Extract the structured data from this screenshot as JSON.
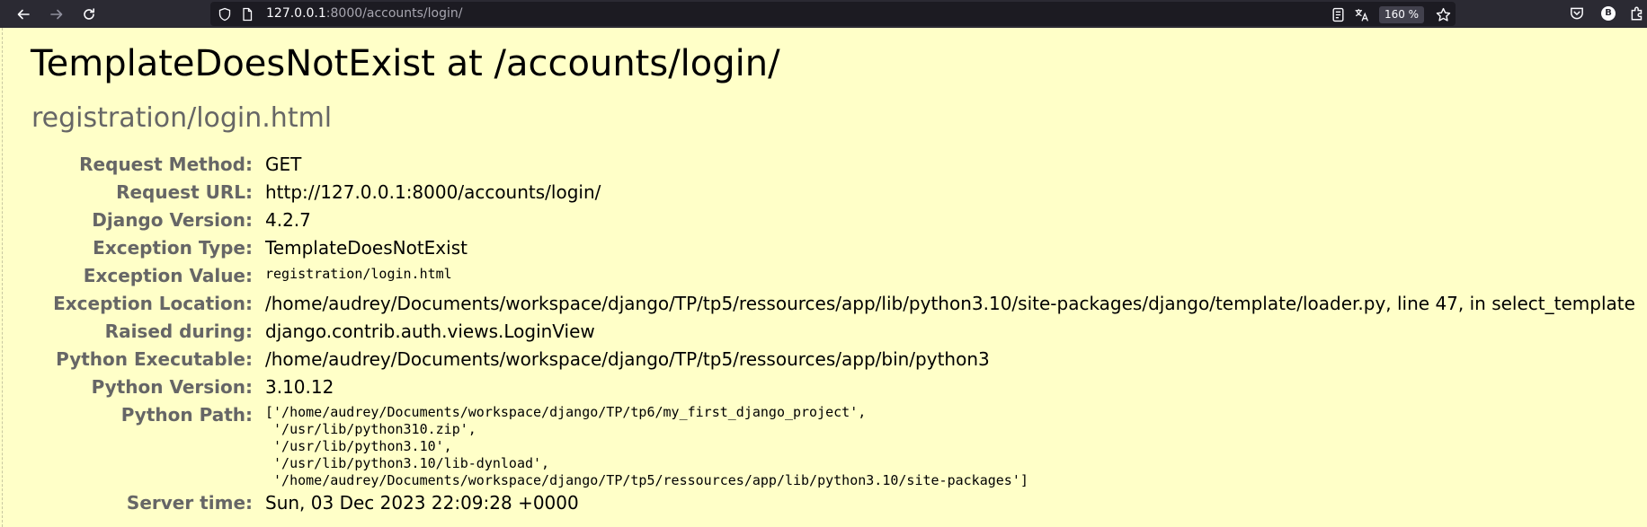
{
  "browser": {
    "url_host": "127.0.0.1",
    "url_path": ":8000/accounts/login/",
    "zoom": "160 %",
    "account_initial": "B",
    "icons": [
      "back-icon",
      "forward-icon",
      "reload-icon",
      "shield-icon",
      "page-icon",
      "reader-view-icon",
      "translate-icon",
      "bookmark-star-icon",
      "pocket-icon",
      "extensions-icon"
    ]
  },
  "page": {
    "title": "TemplateDoesNotExist at /accounts/login/",
    "subtitle": "registration/login.html",
    "rows": [
      {
        "label": "Request Method:",
        "value": "GET"
      },
      {
        "label": "Request URL:",
        "value": "http://127.0.0.1:8000/accounts/login/"
      },
      {
        "label": "Django Version:",
        "value": "4.2.7"
      },
      {
        "label": "Exception Type:",
        "value": "TemplateDoesNotExist"
      },
      {
        "label": "Exception Value:",
        "value": "registration/login.html"
      },
      {
        "label": "Exception Location:",
        "value": "/home/audrey/Documents/workspace/django/TP/tp5/ressources/app/lib/python3.10/site-packages/django/template/loader.py, line 47, in select_template"
      },
      {
        "label": "Raised during:",
        "value": "django.contrib.auth.views.LoginView"
      },
      {
        "label": "Python Executable:",
        "value": "/home/audrey/Documents/workspace/django/TP/tp5/ressources/app/bin/python3"
      },
      {
        "label": "Python Version:",
        "value": "3.10.12"
      },
      {
        "label": "Python Path:",
        "value": "['/home/audrey/Documents/workspace/django/TP/tp6/my_first_django_project',\n '/usr/lib/python310.zip',\n '/usr/lib/python3.10',\n '/usr/lib/python3.10/lib-dynload',\n '/home/audrey/Documents/workspace/django/TP/tp5/ressources/app/lib/python3.10/site-packages']"
      },
      {
        "label": "Server time:",
        "value": "Sun, 03 Dec 2023 22:09:28 +0000"
      }
    ]
  }
}
